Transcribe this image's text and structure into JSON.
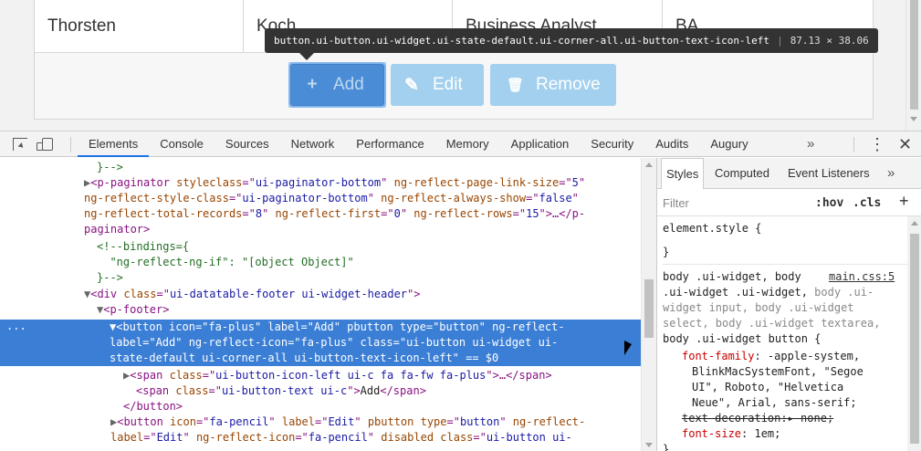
{
  "table_row": {
    "cells": [
      "Thorsten",
      "Koch",
      "Business Analyst",
      "BA"
    ]
  },
  "buttons": {
    "add_icon": "+",
    "add_label": "Add",
    "edit_icon": "✎",
    "edit_label": "Edit",
    "remove_icon": "🗑",
    "remove_label": "Remove"
  },
  "tooltip": {
    "selector": "button.ui-button.ui-widget.ui-state-default.ui-corner-all.ui-button-text-icon-left",
    "separator": "|",
    "size": "87.13 × 38.06"
  },
  "devtools": {
    "tabs": [
      "Elements",
      "Console",
      "Sources",
      "Network",
      "Performance",
      "Memory",
      "Application",
      "Security",
      "Audits",
      "Augury"
    ],
    "active_tab": "Elements",
    "more_tabs": "»",
    "menu": "⋮",
    "close": "✕"
  },
  "dom": {
    "l1": "}-->",
    "l2_a": "<p-paginator ",
    "l2_b": "styleclass",
    "l2_c": "=\"",
    "l2_d": "ui-paginator-bottom",
    "l2_e": "\" ",
    "l2_f": "ng-reflect-page-link-size",
    "l2_g": "=\"",
    "l2_h": "5",
    "l2_i": "\"",
    "l3_a": "ng-reflect-style-class",
    "l3_b": "=\"",
    "l3_c": "ui-paginator-bottom",
    "l3_d": "\" ",
    "l3_e": "ng-reflect-always-show",
    "l3_f": "=\"",
    "l3_g": "false",
    "l3_h": "\"",
    "l4_a": "ng-reflect-total-records",
    "l4_b": "=\"",
    "l4_c": "8",
    "l4_d": "\" ",
    "l4_e": "ng-reflect-first",
    "l4_f": "=\"",
    "l4_g": "0",
    "l4_h": "\" ",
    "l4_i": "ng-reflect-rows",
    "l4_j": "=\"",
    "l4_k": "15",
    "l4_l": "\">…</p-",
    "l5": "paginator>",
    "l6": "<!--bindings={",
    "l7": "  \"ng-reflect-ng-if\": \"[object Object]\"",
    "l8": "}-->",
    "l9_a": "<div ",
    "l9_b": "class",
    "l9_c": "=\"",
    "l9_d": "ui-datatable-footer ui-widget-header",
    "l9_e": "\">",
    "l10": "<p-footer>",
    "sel_dots": "...",
    "l11_a": "<button ",
    "l11_b": "icon",
    "l11_c": "=\"",
    "l11_d": "fa-plus",
    "l11_e": "\" ",
    "l11_f": "label",
    "l11_g": "=\"",
    "l11_h": "Add",
    "l11_i": "\" ",
    "l11_j": "pbutton ",
    "l11_k": "type",
    "l11_l": "=\"",
    "l11_m": "button",
    "l11_n": "\" ",
    "l11_o": "ng-reflect-",
    "l12": "label=\"Add\" ng-reflect-icon=\"fa-plus\" class=\"ui-button ui-widget ui-",
    "l13": "state-default ui-corner-all ui-button-text-icon-left\" == $0",
    "l14_a": "<span ",
    "l14_b": "class",
    "l14_c": "=\"",
    "l14_d": "ui-button-icon-left ui-c fa fa-fw fa-plus",
    "l14_e": "\">…</span>",
    "l15_a": "<span ",
    "l15_b": "class",
    "l15_c": "=\"",
    "l15_d": "ui-button-text ui-c",
    "l15_e": "\">",
    "l15_f": "Add",
    "l15_g": "</span>",
    "l16": "</button>",
    "l17_a": "<button ",
    "l17_b": "icon",
    "l17_c": "=\"",
    "l17_d": "fa-pencil",
    "l17_e": "\" ",
    "l17_f": "label",
    "l17_g": "=\"",
    "l17_h": "Edit",
    "l17_i": "\" ",
    "l17_j": "pbutton ",
    "l17_k": "type",
    "l17_l": "=\"",
    "l17_m": "button",
    "l17_n": "\" ",
    "l17_o": "ng-reflect-",
    "l18_a": "label",
    "l18_b": "=\"",
    "l18_c": "Edit",
    "l18_d": "\" ",
    "l18_e": "ng-reflect-icon",
    "l18_f": "=\"",
    "l18_g": "fa-pencil",
    "l18_h": "\" ",
    "l18_i": "disabled ",
    "l18_j": "class",
    "l18_k": "=\"",
    "l18_l": "ui-button ui-"
  },
  "styles": {
    "tabs": [
      "Styles",
      "Computed",
      "Event Listeners"
    ],
    "more": "»",
    "filter_placeholder": "Filter",
    "hov": ":hov",
    "cls": ".cls",
    "add": "+",
    "element_style": "element.style {",
    "close_brace": "}",
    "r1_a": "body .ui-widget, body ",
    "r1_src": "main.css:5",
    "r2_a": ".ui-widget .ui-widget, ",
    "r2_b": "body .ui-",
    "r3": "widget input, body .ui-widget",
    "r4": "select, body .ui-widget textarea,",
    "r5": "body .ui-widget button {",
    "p1_name": "font-family",
    "p1_val": ": -apple-system,",
    "p2": "BlinkMacSystemFont, \"Segoe",
    "p3": "UI\", Roboto, \"Helvetica",
    "p4": "Neue\", Arial, sans-serif;",
    "p5_name": "text-decoration",
    "p5_val": ":▸ none;",
    "p6_name": "font-size",
    "p6_val": ": 1em;",
    "end": "}"
  }
}
